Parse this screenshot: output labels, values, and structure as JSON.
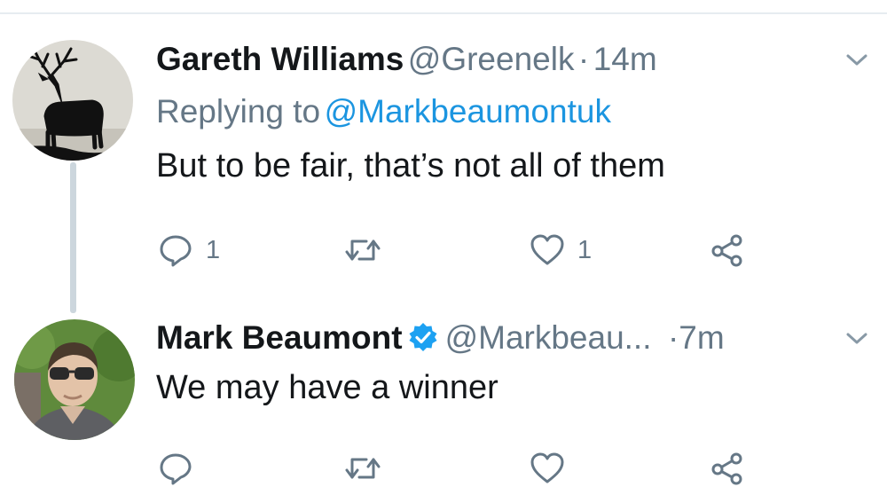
{
  "tweet1": {
    "name": "Gareth Williams",
    "handle": "@Greenelk",
    "dot": "·",
    "time": "14m",
    "replying_prefix": "Replying to",
    "replying_handle": "@Markbeaumontuk",
    "text": "But to be fair, that’s not all of them",
    "reply_count": "1",
    "like_count": "1"
  },
  "tweet2": {
    "name": "Mark Beaumont",
    "handle": "@Markbeau...",
    "dot": "·",
    "time": "7m",
    "text": "We may have a winner",
    "reply_count": "",
    "like_count": ""
  },
  "icons": {
    "reply": "reply-icon",
    "retweet": "retweet-icon",
    "like": "heart-icon",
    "share": "share-icon",
    "more": "chevron-down-icon",
    "verified": "verified-badge-icon"
  },
  "colors": {
    "text": "#14171a",
    "muted": "#657786",
    "link": "#1b95e0",
    "verified": "#1da1f2",
    "thread_line": "#ccd6dd"
  }
}
